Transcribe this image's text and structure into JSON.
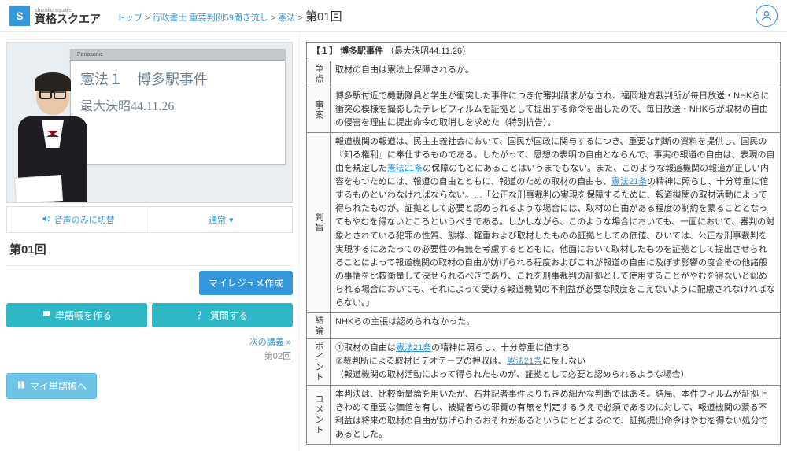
{
  "header": {
    "logo_sub": "shikaku square",
    "logo_main": "資格スクエア",
    "breadcrumb": {
      "top": "トップ",
      "course": "行政書士 重要判例59聞き流し",
      "subject": "憲法"
    },
    "page_title": "第01回"
  },
  "video": {
    "whiteboard_brand": "Panasonic",
    "line1_left": "憲法１",
    "line1_right": "博多駅事件",
    "line2": "最大決昭44.11.26"
  },
  "controls": {
    "audio_only": "音声のみに切替",
    "speed": "通常"
  },
  "lesson": {
    "title": "第01回",
    "create_resume": "マイレジュメ作成",
    "make_wordbook": "単語帳を作る",
    "ask_question": "質問する",
    "next_link": "次の講義 »",
    "next_sub": "第02回",
    "my_wordbook": "マイ単語帳へ"
  },
  "case": {
    "header_num": "【１】",
    "header_title": "博多駅事件",
    "header_meta": "（最大決昭44.11.26）",
    "rows": {
      "issue_label": "争点",
      "issue": "取材の自由は憲法上保障されるか。",
      "facts_label": "事案",
      "facts": "博多駅付近で機動隊員と学生が衝突した事件につき付審判請求がなされ、福岡地方裁判所が毎日放送・NHKらに衝突の模様を撮影したテレビフィルムを証拠として提出する命令を出したので、毎日放送・NHKらが取材の自由の侵害を理由に提出命令の取消しを求めた（特別抗告）。",
      "gist_label": "判旨",
      "gist_pre": "報道機関の報道は、民主主義社会において、国民が国政に関与するにつき、重要な判断の資料を提供し、国民の『知る権利』に奉仕するものである。したがって、思想の表明の自由とならんで、事実の報道の自由は、表現の自由を規定した",
      "gist_link1": "憲法21条",
      "gist_mid1": "の保障のもとにあることはいうまでもない。また、このような報道機関の報道が正しい内容をもつためには、報道の自由とともに、報道のための取材の自由も、",
      "gist_link2": "憲法21条",
      "gist_mid2": "の精神に照らし、十分尊重に値するものといわなければならない。…「公正な刑事裁判の実現を保障するために、報道機関の取材活動によって得られたものが、証拠として必要と認められるような場合には、取材の自由がある程度の制約を蒙ることとなってもやむを得ないところというべきである。しかしながら、このような場合においても、一面において、審判の対象とされている犯罪の性質、態様、軽重および取材したものの証拠としての価値、ひいては、公正な刑事裁判を実現するにあたっての必要性の有無を考慮するとともに、他面において取材したものを証拠として提出させられることによって報道機関の取材の自由が妨げられる程度およびこれが報道の自由に及ぼす影響の度合その他諸般の事情を比較衡量して決せられるべきであり、これを刑事裁判の証拠として使用することがやむを得ないと認められる場合においても、それによって受ける報道機関の不利益が必要な限度をこえないように配慮されなければならない。」",
      "conc_label": "結論",
      "conc": "NHKらの主張は認められなかった。",
      "point_label": "ポイント",
      "point_l1a": "①取材の自由は",
      "point_l1_link": "憲法21条",
      "point_l1b": "の精神に照らし、十分尊重に値する",
      "point_l2a": "②裁判所による取材ビデオテープの押収は、",
      "point_l2_link": "憲法21条",
      "point_l2b": "に反しない",
      "point_l3": "（報道機関の取材活動によって得られたものが、証拠として必要と認められるような場合）",
      "comment_label": "コメント",
      "comment": "本判決は、比較衡量論を用いたが、石井記者事件よりもきめ細かな判断ではある。結局、本件フィルムが証拠上きわめて重要な価値を有し、被疑者らの罪責の有無を判定するうえで必須であるのに対して、報道機関の蒙る不利益は将来の取材の自由が妨げられるおそれがあるというにとどまるので、証拠提出命令はやむを得ない処分であるとした。"
    }
  }
}
